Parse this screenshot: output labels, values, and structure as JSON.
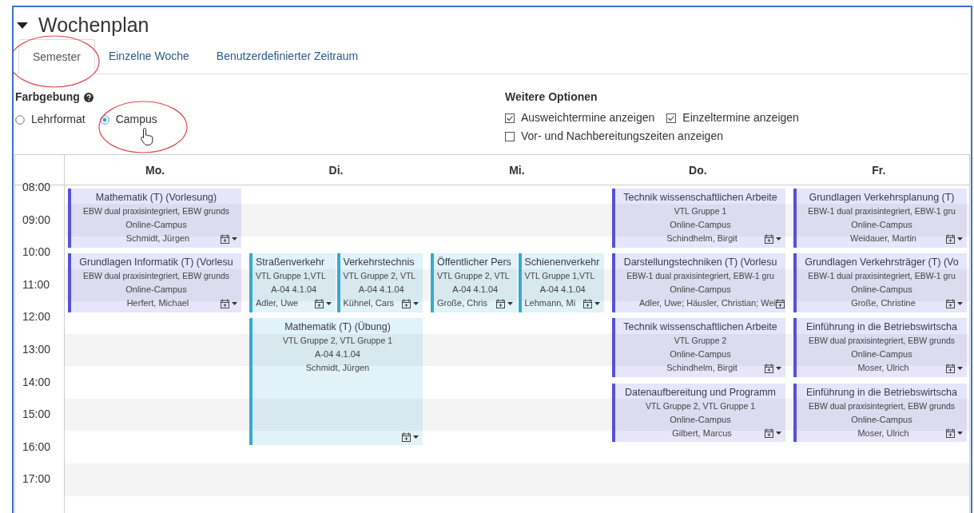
{
  "section": {
    "title": "Wochenplan",
    "expanded": true
  },
  "tabs": [
    {
      "label": "Semester",
      "selected": true
    },
    {
      "label": "Einzelne Woche",
      "selected": false
    },
    {
      "label": "Benutzerdefinierter Zeitraum",
      "selected": false
    }
  ],
  "coloring": {
    "label": "Farbgebung",
    "options": [
      {
        "label": "Lehrformat",
        "selected": false
      },
      {
        "label": "Campus",
        "selected": true
      }
    ]
  },
  "more_options": {
    "label": "Weitere Optionen",
    "options": [
      {
        "label": "Ausweichtermine anzeigen",
        "checked": true
      },
      {
        "label": "Einzeltermine anzeigen",
        "checked": true
      },
      {
        "label": "Vor- und Nachbereitungszeiten anzeigen",
        "checked": false
      }
    ]
  },
  "calendar": {
    "hours": [
      "08:00",
      "09:00",
      "10:00",
      "11:00",
      "12:00",
      "13:00",
      "14:00",
      "15:00",
      "16:00",
      "17:00"
    ],
    "days": [
      {
        "label": "Mo.",
        "slots": [
          {
            "kind": "first",
            "events": [
              {
                "kind": "block",
                "color": "#5750d8",
                "title": "Mathematik (T) (Vorlesung)",
                "groups": "EBW dual praxisintegriert, EBW grunds",
                "location": "Online-Campus",
                "lecturer": "Schmidt, Jürgen"
              }
            ]
          },
          {
            "kind": "second",
            "events": [
              {
                "kind": "block",
                "color": "#5750d8",
                "title": "Grundlagen Informatik (T) (Vorlesu",
                "groups": "EBW dual praxisintegriert, EBW grunds",
                "location": "Online-Campus",
                "lecturer": "Herfert, Michael"
              }
            ]
          }
        ]
      },
      {
        "label": "Di.",
        "slots": [
          {
            "kind": "second",
            "events": [
              {
                "kind": "block",
                "color": "#36a9d3",
                "title": "Straßenverkehr",
                "groups": "VTL Gruppe 1,VTL",
                "location": "A-04 4.1.04",
                "lecturer": "Adler, Uwe"
              },
              {
                "kind": "block",
                "color": "#36a9d3",
                "title": "Verkehrstechnis",
                "groups": "VTL Gruppe 2, VTL",
                "location": "A-04 4.1.04",
                "lecturer": "Kühnel, Cars"
              }
            ]
          },
          {
            "kind": "third",
            "events": [
              {
                "kind": "long",
                "color": "#36a9d3",
                "title": "Mathematik (T) (Übung)",
                "groups": "VTL Gruppe 2, VTL Gruppe 1",
                "location": "A-04 4.1.04",
                "lecturer": "Schmidt, Jürgen"
              }
            ]
          }
        ]
      },
      {
        "label": "Mi.",
        "slots": [
          {
            "kind": "second",
            "events": [
              {
                "kind": "block",
                "color": "#36a9d3",
                "title": "Öffentlicher Pers",
                "groups": "VTL Gruppe 2, VTL",
                "location": "A-04 4.1.04",
                "lecturer": "Große, Chris"
              },
              {
                "kind": "block",
                "color": "#36a9d3",
                "title": "Schienenverkehr",
                "groups": "VTL Gruppe 1,VTL",
                "location": "A-04 4.1.04",
                "lecturer": "Lehmann, Mi"
              }
            ]
          }
        ]
      },
      {
        "label": "Do.",
        "slots": [
          {
            "kind": "first",
            "events": [
              {
                "kind": "block",
                "color": "#5750d8",
                "title": "Technik wissenschaftlichen Arbeite",
                "groups": "VTL Gruppe 1",
                "location": "Online-Campus",
                "lecturer": "Schindhelm, Birgit"
              }
            ]
          },
          {
            "kind": "second",
            "events": [
              {
                "kind": "block",
                "color": "#5750d8",
                "title": "Darstellungstechniken (T) (Vorlesu",
                "groups": "EBW-1 dual praxisintegriert, EBW-1 gru",
                "location": "Online-Campus",
                "lecturer": "Adler, Uwe; Häusler, Christian; Wei"
              }
            ]
          },
          {
            "kind": "third",
            "events": [
              {
                "kind": "block",
                "color": "#5750d8",
                "title": "Technik wissenschaftlichen Arbeite",
                "groups": "VTL Gruppe 2",
                "location": "Online-Campus",
                "lecturer": "Schindhelm, Birgit"
              }
            ]
          },
          {
            "kind": "fourth",
            "events": [
              {
                "kind": "block",
                "color": "#5750d8",
                "title": "Datenaufbereitung und Programm",
                "groups": "VTL Gruppe 2, VTL Gruppe 1",
                "location": "Online-Campus",
                "lecturer": "Gilbert, Marcus"
              }
            ]
          }
        ]
      },
      {
        "label": "Fr.",
        "slots": [
          {
            "kind": "first",
            "events": [
              {
                "kind": "block",
                "color": "#5750d8",
                "title": "Grundlagen Verkehrsplanung (T)",
                "groups": "EBW-1 dual praxisintegriert, EBW-1 gru",
                "location": "Online-Campus",
                "lecturer": "Weidauer, Martin"
              }
            ]
          },
          {
            "kind": "second",
            "events": [
              {
                "kind": "block",
                "color": "#5750d8",
                "title": "Grundlagen Verkehrsträger (T) (Vo",
                "groups": "EBW-1 dual praxisintegriert, EBW-1 gru",
                "location": "Online-Campus",
                "lecturer": "Große, Christine"
              }
            ]
          },
          {
            "kind": "third",
            "events": [
              {
                "kind": "block",
                "color": "#5750d8",
                "title": "Einführung in die Betriebswirtscha",
                "groups": "EBW dual praxisintegriert, EBW grunds",
                "location": "Online-Campus",
                "lecturer": "Moser, Ulrich"
              }
            ]
          },
          {
            "kind": "fourth",
            "events": [
              {
                "kind": "block",
                "color": "#5750d8",
                "title": "Einführung in die Betriebswirtscha",
                "groups": "EBW dual praxisintegriert, EBW grunds",
                "location": "Online-Campus",
                "lecturer": "Moser, Ulrich"
              }
            ]
          }
        ]
      }
    ]
  }
}
